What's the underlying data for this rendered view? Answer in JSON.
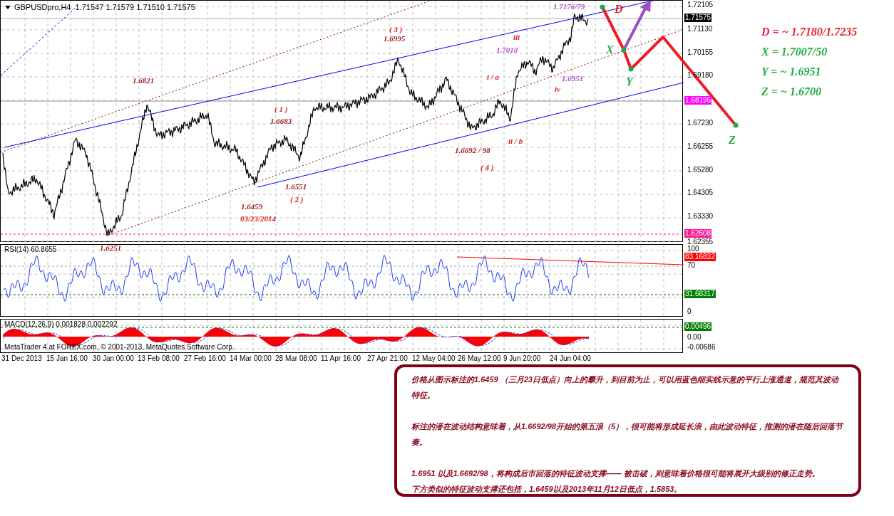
{
  "chart": {
    "header": "GBPUSDpro,H4  1.71547 1.71579 1.71510 1.71575",
    "annotations": [
      {
        "text": "1.6821",
        "color": "#9b1c1c"
      },
      {
        "text": "( 3 )",
        "color": "#e02020"
      },
      {
        "text": "1.6995",
        "color": "#9b1c1c"
      },
      {
        "text": "1.7176/79",
        "color": "#b050c8"
      },
      {
        "text": "iii",
        "color": "#e02020"
      },
      {
        "text": "1.7010",
        "color": "#b050c8"
      },
      {
        "text": "i / a",
        "color": "#e02020"
      },
      {
        "text": "1.6951",
        "color": "#b050c8"
      },
      {
        "text": "iv",
        "color": "#e02020"
      },
      {
        "text": "( 1 )",
        "color": "#e02020"
      },
      {
        "text": "1.6683",
        "color": "#9b1c1c"
      },
      {
        "text": "ii / b",
        "color": "#e02020"
      },
      {
        "text": "1.6692 / 98",
        "color": "#9b1c1c"
      },
      {
        "text": "( 4 )",
        "color": "#e02020"
      },
      {
        "text": "1.6551",
        "color": "#9b1c1c"
      },
      {
        "text": "( 2 )",
        "color": "#e02020"
      },
      {
        "text": "1.6459",
        "color": "#9b1c1c"
      },
      {
        "text": "03/23/2014",
        "color": "#e02020"
      },
      {
        "text": "1.6251",
        "color": "#9b1c1c"
      }
    ],
    "price_axis": [
      {
        "text": "1.72105",
        "kind": "tick"
      },
      {
        "text": "1.71575",
        "kind": "badge",
        "color": "#000000"
      },
      {
        "text": "1.71130",
        "kind": "tick"
      },
      {
        "text": "1.70155",
        "kind": "tick"
      },
      {
        "text": "1.69180",
        "kind": "tick"
      },
      {
        "text": "1.68196",
        "kind": "badge",
        "color": "#ff00ff"
      },
      {
        "text": "1.67230",
        "kind": "tick"
      },
      {
        "text": "1.66255",
        "kind": "tick"
      },
      {
        "text": "1.65280",
        "kind": "tick"
      },
      {
        "text": "1.64305",
        "kind": "tick"
      },
      {
        "text": "1.63330",
        "kind": "tick"
      },
      {
        "text": "1.62608",
        "kind": "badge",
        "color": "#ff1493"
      },
      {
        "text": "1.62355",
        "kind": "tick"
      }
    ],
    "rsi": {
      "label": "RSI(14) 60.8655",
      "axis": [
        {
          "text": "100",
          "kind": "tick"
        },
        {
          "text": "83.16832",
          "kind": "badge",
          "color": "#ff0000"
        },
        {
          "text": "70",
          "kind": "tick"
        },
        {
          "text": "31.68317",
          "kind": "badge",
          "color": "#008000"
        },
        {
          "text": "0",
          "kind": "tick"
        }
      ]
    },
    "macd": {
      "label": "MACD(12,26,9) 0.001828 0.002292",
      "axis": [
        {
          "text": "0.00496",
          "kind": "badge",
          "color": "#008000"
        },
        {
          "text": "0.00",
          "kind": "tick"
        },
        {
          "text": "-0.00686",
          "kind": "tick"
        }
      ]
    },
    "copyright": "MetaTrader 4 at FOREX.com, © 2001-2013, MetaQuotes Software Corp.",
    "time_axis": [
      "31 Dec 2013",
      "15 Jan 16:00",
      "30 Jan 00:00",
      "13 Feb 08:00",
      "27 Feb 16:00",
      "14 Mar 00:00",
      "28 Mar 08:00",
      "11 Apr 16:00",
      "27 Apr 21:00",
      "12 May 04:00",
      "26 May 12:00",
      "9 Jun 20:00",
      "24 Jun 04:00"
    ]
  },
  "forecast_points": [
    {
      "text": "D",
      "color": "#e02020"
    },
    {
      "text": "X",
      "color": "#22aa44"
    },
    {
      "text": "Y",
      "color": "#22aa44"
    },
    {
      "text": "Z",
      "color": "#22aa44"
    }
  ],
  "legend": [
    {
      "text": "D = ~ 1.7180/1.7235",
      "color": "#e82030"
    },
    {
      "text": "X = 1.7007/50",
      "color": "#22aa44"
    },
    {
      "text": "Y = ~ 1.6951",
      "color": "#22aa44"
    },
    {
      "text": "Z = ~ 1.6700",
      "color": "#22aa44"
    }
  ],
  "note": {
    "paragraphs": [
      [
        "价格从图示标注的1.6459 （三月23日低点）向上的攀升，到目前为止，可以用蓝色细实线示意的平行上涨通道，规范其波动特征。"
      ],
      [
        "标注的潜在波动结构意味着，从1.6692/98开始的第五浪（5），很可能将形成延长浪，由此波动特征，推测的潜在随后回落节奏。"
      ],
      [
        "1.6951 以及1.6692/98，将构成后市回落的特征波动支撑—— 被击破，则意味着价格很可能将展开大级别的修正走势。",
        "下方类似的特征波动支撑还包括，1.6459以及2013年11月12日低点，1.5853。"
      ]
    ]
  }
}
